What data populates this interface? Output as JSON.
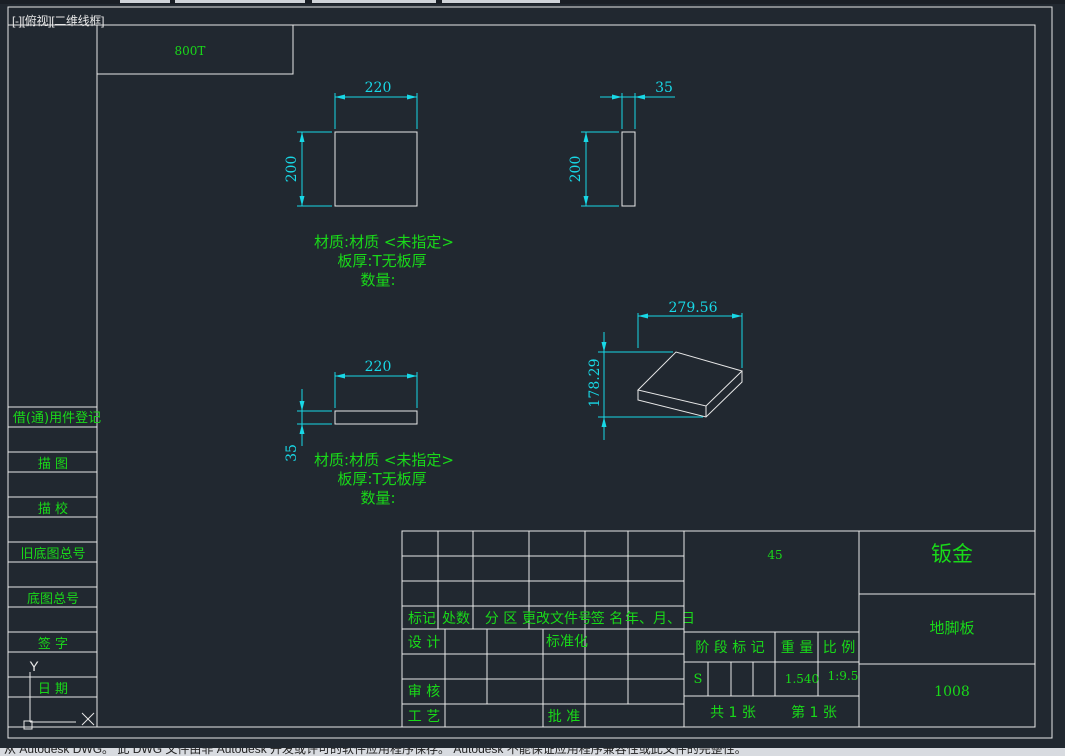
{
  "viewport": {
    "label": "[-][俯视][二维线框]"
  },
  "status_bar": {
    "text": "从 Autodesk DWG。 此 DWG 文件由非 Autodesk 开发或许可的软件应用程序保存。 Autodesk 不能保证应用程序兼容性或此文件的完整性。"
  },
  "code_box": "800T",
  "views": {
    "front": {
      "width_dim": "220",
      "height_dim": "200"
    },
    "side": {
      "width_dim": "35",
      "height_dim": "200"
    },
    "top": {
      "width_dim": "220",
      "height_dim": "35"
    },
    "iso": {
      "width_dim": "279.56",
      "height_dim": "178.29"
    }
  },
  "notes": [
    {
      "material": "材质:材质 <未指定>",
      "thickness": "板厚:T无板厚",
      "quantity": "数量:"
    },
    {
      "material": "材质:材质 <未指定>",
      "thickness": "板厚:T无板厚",
      "quantity": "数量:"
    }
  ],
  "left_column": [
    "借(通)用件登记",
    "描  图",
    "描  校",
    "旧底图总号",
    "底图总号",
    "签  字",
    "日  期"
  ],
  "title_block": {
    "headers": [
      "标记",
      "处数",
      "分 区",
      "更改文件号",
      "签 名",
      "年、月、日"
    ],
    "roles": {
      "design": "设 计",
      "standard": "标准化",
      "review": "审 核",
      "process": "工 艺",
      "approve": "批 准"
    },
    "material_code": "45",
    "stage_label": "阶 段 标 记",
    "weight_label": "重 量",
    "scale_label": "比 例",
    "stage_value": "S",
    "weight_value": "1.540",
    "scale_value": "1:9.5",
    "sheets_total": "共  1  张",
    "sheet_number": "第  1  张",
    "category": "钣金",
    "part_name": "地脚板",
    "drawing_number": "1008"
  },
  "ucs": {
    "y_label": "Y"
  }
}
